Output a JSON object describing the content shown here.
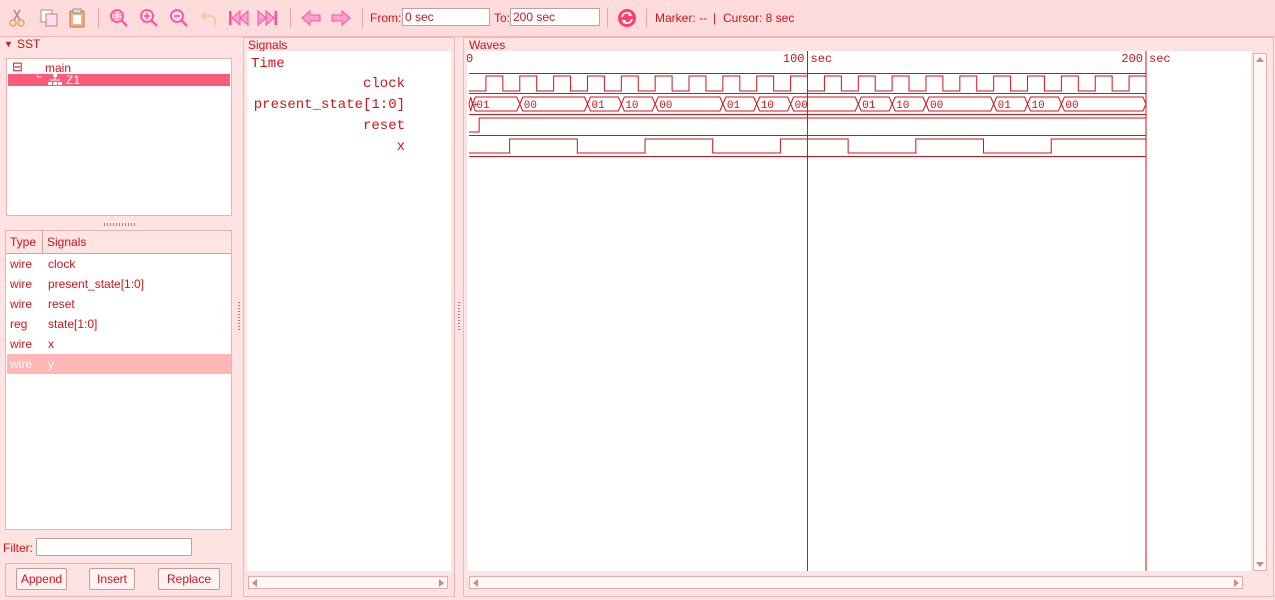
{
  "toolbar": {
    "icons": [
      "cut-icon",
      "copy-icon",
      "paste-icon",
      "zoom-fit-icon",
      "zoom-in-icon",
      "zoom-out-icon",
      "undo-icon",
      "jump-start-icon",
      "jump-end-icon",
      "prev-edge-icon",
      "next-edge-icon",
      "reload-icon"
    ],
    "from_label": "From:",
    "from_value": "0 sec",
    "to_label": "To:",
    "to_value": "200 sec",
    "marker_text": "Marker: --",
    "separator": "|",
    "cursor_text": "Cursor: 8 sec"
  },
  "sst": {
    "title": "SST",
    "tree": [
      {
        "label": "main",
        "toggle": "⊟"
      },
      {
        "label": "Z1",
        "selected": true
      }
    ],
    "table_headers": [
      "Type",
      "Signals"
    ],
    "signals": [
      {
        "type": "wire",
        "name": "clock"
      },
      {
        "type": "wire",
        "name": "present_state[1:0]"
      },
      {
        "type": "wire",
        "name": "reset"
      },
      {
        "type": "reg",
        "name": "state[1:0]"
      },
      {
        "type": "wire",
        "name": "x"
      },
      {
        "type": "wire",
        "name": "y",
        "selected": true
      }
    ],
    "filter_label": "Filter:",
    "filter_value": "",
    "buttons": {
      "append": "Append",
      "insert": "Insert",
      "replace": "Replace"
    }
  },
  "signals_panel": {
    "title": "Signals",
    "time_label": "Time",
    "names": [
      "clock",
      "present_state[1:0]",
      "reset",
      "x"
    ]
  },
  "waves_panel": {
    "title": "Waves",
    "time_start": "0",
    "time_end": 200,
    "time_markers": [
      {
        "value": 100,
        "label": "100",
        "unit": "sec"
      },
      {
        "value": 200,
        "label": "200",
        "unit": "sec"
      }
    ],
    "clock_half_period": 5,
    "present_state_segments": [
      {
        "start": 0,
        "end": 1,
        "label": "+"
      },
      {
        "start": 1,
        "end": 15,
        "label": "01"
      },
      {
        "start": 15,
        "end": 35,
        "label": "00"
      },
      {
        "start": 35,
        "end": 45,
        "label": "01"
      },
      {
        "start": 45,
        "end": 55,
        "label": "10"
      },
      {
        "start": 55,
        "end": 75,
        "label": "00"
      },
      {
        "start": 75,
        "end": 85,
        "label": "01"
      },
      {
        "start": 85,
        "end": 95,
        "label": "10"
      },
      {
        "start": 95,
        "end": 115,
        "label": "00"
      },
      {
        "start": 115,
        "end": 125,
        "label": "01"
      },
      {
        "start": 125,
        "end": 135,
        "label": "10"
      },
      {
        "start": 135,
        "end": 155,
        "label": "00"
      },
      {
        "start": 155,
        "end": 165,
        "label": "01"
      },
      {
        "start": 165,
        "end": 175,
        "label": "10"
      },
      {
        "start": 175,
        "end": 200,
        "label": "00"
      }
    ],
    "reset_transitions": [
      [
        0,
        0
      ],
      [
        3,
        1
      ]
    ],
    "x_transitions": [
      [
        0,
        0
      ],
      [
        12,
        1
      ],
      [
        32,
        0
      ],
      [
        52,
        1
      ],
      [
        72,
        0
      ],
      [
        92,
        1
      ],
      [
        112,
        0
      ],
      [
        132,
        1
      ],
      [
        152,
        0
      ],
      [
        172,
        1
      ]
    ]
  }
}
